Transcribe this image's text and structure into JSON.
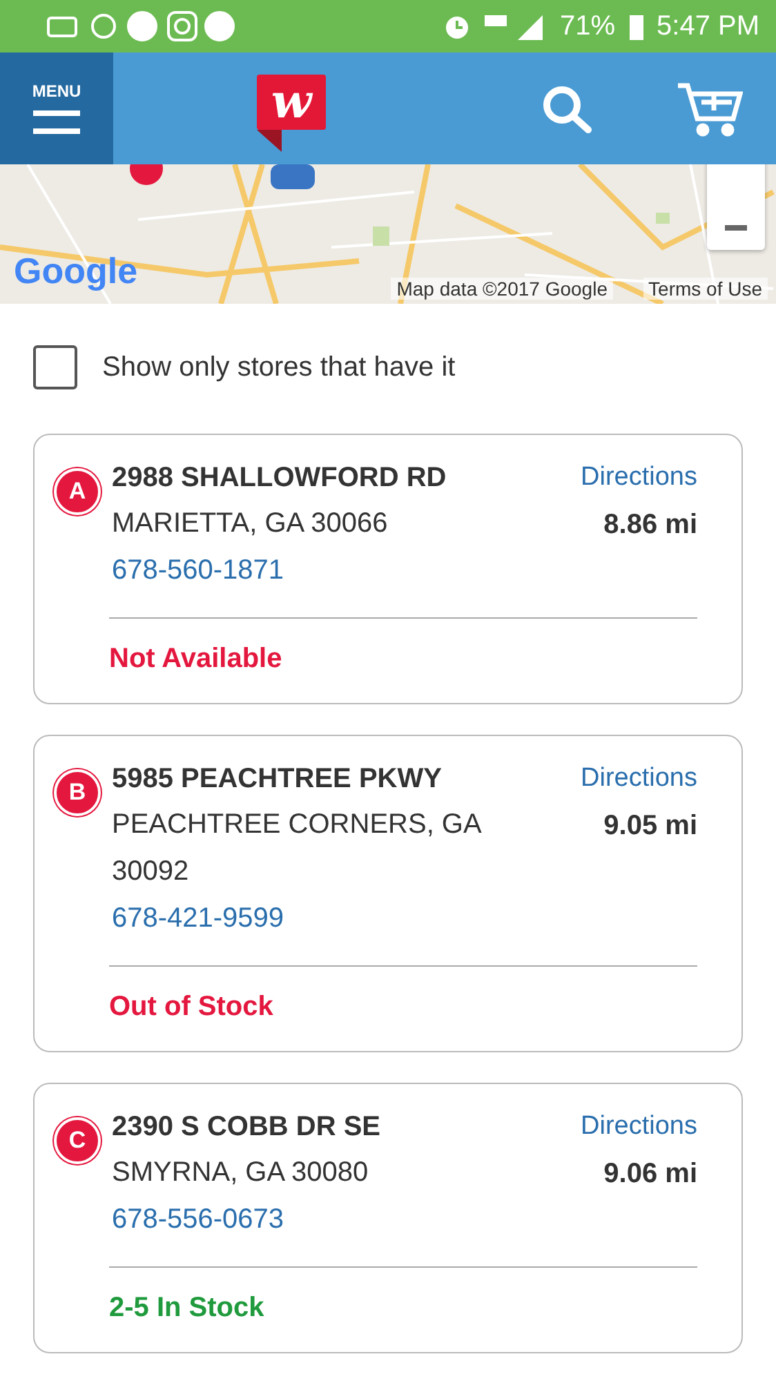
{
  "status_bar": {
    "battery": "71%",
    "time": "5:47 PM"
  },
  "header": {
    "menu_label": "MENU",
    "logo": "w"
  },
  "map": {
    "logo": "Google",
    "attribution": "Map data ©2017 Google",
    "terms": "Terms of Use"
  },
  "filter": {
    "label": "Show only stores that have it",
    "checked": false
  },
  "stores": [
    {
      "marker": "A",
      "address": "2988 SHALLOWFORD RD",
      "city": "MARIETTA, GA 30066",
      "phone": "678-560-1871",
      "directions": "Directions",
      "distance": "8.86 mi",
      "status": "Not Available",
      "color": "#e4173e"
    },
    {
      "marker": "B",
      "address": "5985 PEACHTREE PKWY",
      "city": "PEACHTREE CORNERS, GA 30092",
      "phone": "678-421-9599",
      "directions": "Directions",
      "distance": "9.05 mi",
      "status": "Out of Stock",
      "color": "#e4173e"
    },
    {
      "marker": "C",
      "address": "2390 S COBB DR SE",
      "city": "SMYRNA, GA 30080",
      "phone": "678-556-0673",
      "directions": "Directions",
      "distance": "9.06 mi",
      "status": "2-5 In Stock",
      "color": "#1f9a3c"
    }
  ]
}
